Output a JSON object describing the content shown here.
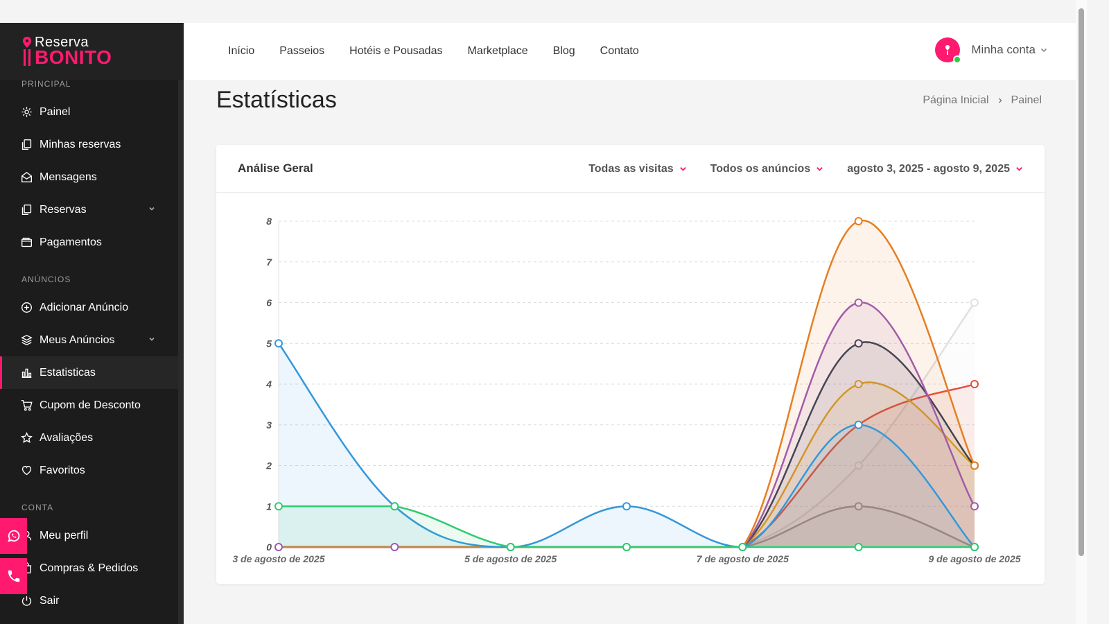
{
  "brand": {
    "line1": "Reserva",
    "line2": "BONITO",
    "accent": "#ff1a70"
  },
  "sidebar": {
    "sections": [
      {
        "label": "PRINCIPAL",
        "items": [
          {
            "label": "Painel",
            "icon": "gear-icon"
          },
          {
            "label": "Minhas reservas",
            "icon": "copy-icon"
          },
          {
            "label": "Mensagens",
            "icon": "envelope-icon"
          },
          {
            "label": "Reservas",
            "icon": "copy-icon",
            "expandable": true
          },
          {
            "label": "Pagamentos",
            "icon": "wallet-icon"
          }
        ]
      },
      {
        "label": "ANÚNCIOS",
        "items": [
          {
            "label": "Adicionar Anúncio",
            "icon": "plus-circle-icon"
          },
          {
            "label": "Meus Anúncios",
            "icon": "layers-icon",
            "expandable": true
          },
          {
            "label": "Estatisticas",
            "icon": "bar-chart-icon",
            "active": true
          },
          {
            "label": "Cupom de Desconto",
            "icon": "cart-icon"
          },
          {
            "label": "Avaliações",
            "icon": "star-icon"
          },
          {
            "label": "Favoritos",
            "icon": "heart-icon"
          }
        ]
      },
      {
        "label": "CONTA",
        "items": [
          {
            "label": "Meu perfil",
            "icon": "user-icon"
          },
          {
            "label": "Compras & Pedidos",
            "icon": "bag-icon"
          },
          {
            "label": "Sair",
            "icon": "power-icon"
          }
        ]
      }
    ]
  },
  "header": {
    "nav": [
      "Início",
      "Passeios",
      "Hotéis e Pousadas",
      "Marketplace",
      "Blog",
      "Contato"
    ],
    "account_label": "Minha conta",
    "online_color": "#2ecc40"
  },
  "page": {
    "title": "Estatísticas",
    "breadcrumb": [
      "Página Inicial",
      "Painel"
    ]
  },
  "card": {
    "title": "Análise Geral",
    "filters": [
      "Todas as visitas",
      "Todos os anúncios",
      "agosto 3, 2025 - agosto 9, 2025"
    ]
  },
  "chart_data": {
    "type": "area",
    "categories": [
      "3 de agosto de 2025",
      "4 de agosto de 2025",
      "5 de agosto de 2025",
      "6 de agosto de 2025",
      "7 de agosto de 2025",
      "8 de agosto de 2025",
      "9 de agosto de 2025"
    ],
    "tick_labels": [
      "3 de agosto de 2025",
      "5 de agosto de 2025",
      "7 de agosto de 2025",
      "9 de agosto de 2025"
    ],
    "y_ticks": [
      0,
      1,
      2,
      3,
      4,
      5,
      6,
      7,
      8
    ],
    "ylim": [
      0,
      8
    ],
    "grid": true,
    "series": [
      {
        "color": "#e0e0e0",
        "values": [
          0,
          0,
          0,
          0,
          0,
          2,
          6
        ]
      },
      {
        "color": "#999999",
        "values": [
          0,
          0,
          0,
          0,
          0,
          1,
          0
        ]
      },
      {
        "color": "#e74c3c",
        "values": [
          0,
          0,
          0,
          0,
          0,
          3,
          4
        ]
      },
      {
        "color": "#e6a91a",
        "values": [
          0,
          0,
          0,
          0,
          0,
          4,
          2
        ]
      },
      {
        "color": "#2c3e50",
        "values": [
          0,
          0,
          0,
          0,
          0,
          5,
          2
        ]
      },
      {
        "color": "#9b59b6",
        "values": [
          0,
          0,
          0,
          0,
          0,
          6,
          1
        ]
      },
      {
        "color": "#e67e22",
        "values": [
          0,
          0,
          0,
          0,
          0,
          8,
          2
        ]
      },
      {
        "color": "#3498db",
        "values": [
          5,
          1,
          0,
          1,
          0,
          3,
          0
        ]
      },
      {
        "color": "#2ecc71",
        "values": [
          1,
          1,
          0,
          0,
          0,
          0,
          0
        ]
      }
    ]
  }
}
